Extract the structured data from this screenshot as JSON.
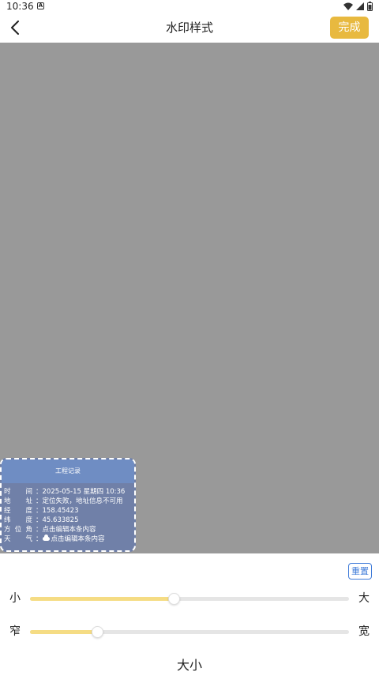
{
  "status_bar": {
    "time": "10:36",
    "a_badge": "A",
    "icons": [
      "wifi-icon",
      "signal-icon",
      "battery-icon"
    ]
  },
  "header": {
    "title": "水印样式",
    "done_label": "完成",
    "back_icon": "chevron-left-icon"
  },
  "watermark": {
    "title": "工程记录",
    "rows": [
      {
        "label": [
          "时",
          "间"
        ],
        "value": "2025-05-15 星期四 10:36"
      },
      {
        "label": [
          "地",
          "址"
        ],
        "value": "定位失败，地址信息不可用"
      },
      {
        "label": [
          "经",
          "度"
        ],
        "value": "158.45423"
      },
      {
        "label": [
          "纬",
          "度"
        ],
        "value": "45.633825"
      },
      {
        "label": [
          "方",
          "位",
          "角"
        ],
        "value": "点击编辑本条内容"
      },
      {
        "label": [
          "天",
          "气"
        ],
        "value": "点击编辑本条内容",
        "icon": "cloud-icon"
      }
    ]
  },
  "controls": {
    "reset_label": "重置",
    "size_slider": {
      "min_label": "小",
      "max_label": "大",
      "value_fraction": 0.45
    },
    "width_slider": {
      "min_label": "窄",
      "max_label": "宽",
      "value_fraction": 0.21
    }
  },
  "tabs": {
    "size_label": "大小"
  },
  "colors": {
    "accent": "#e8b93f",
    "slider_fill": "#f5dc84",
    "reset_blue": "#3f7bd9",
    "preview_bg": "#999999",
    "watermark_header": "#6f8dc3",
    "watermark_body": "#7080a8"
  }
}
